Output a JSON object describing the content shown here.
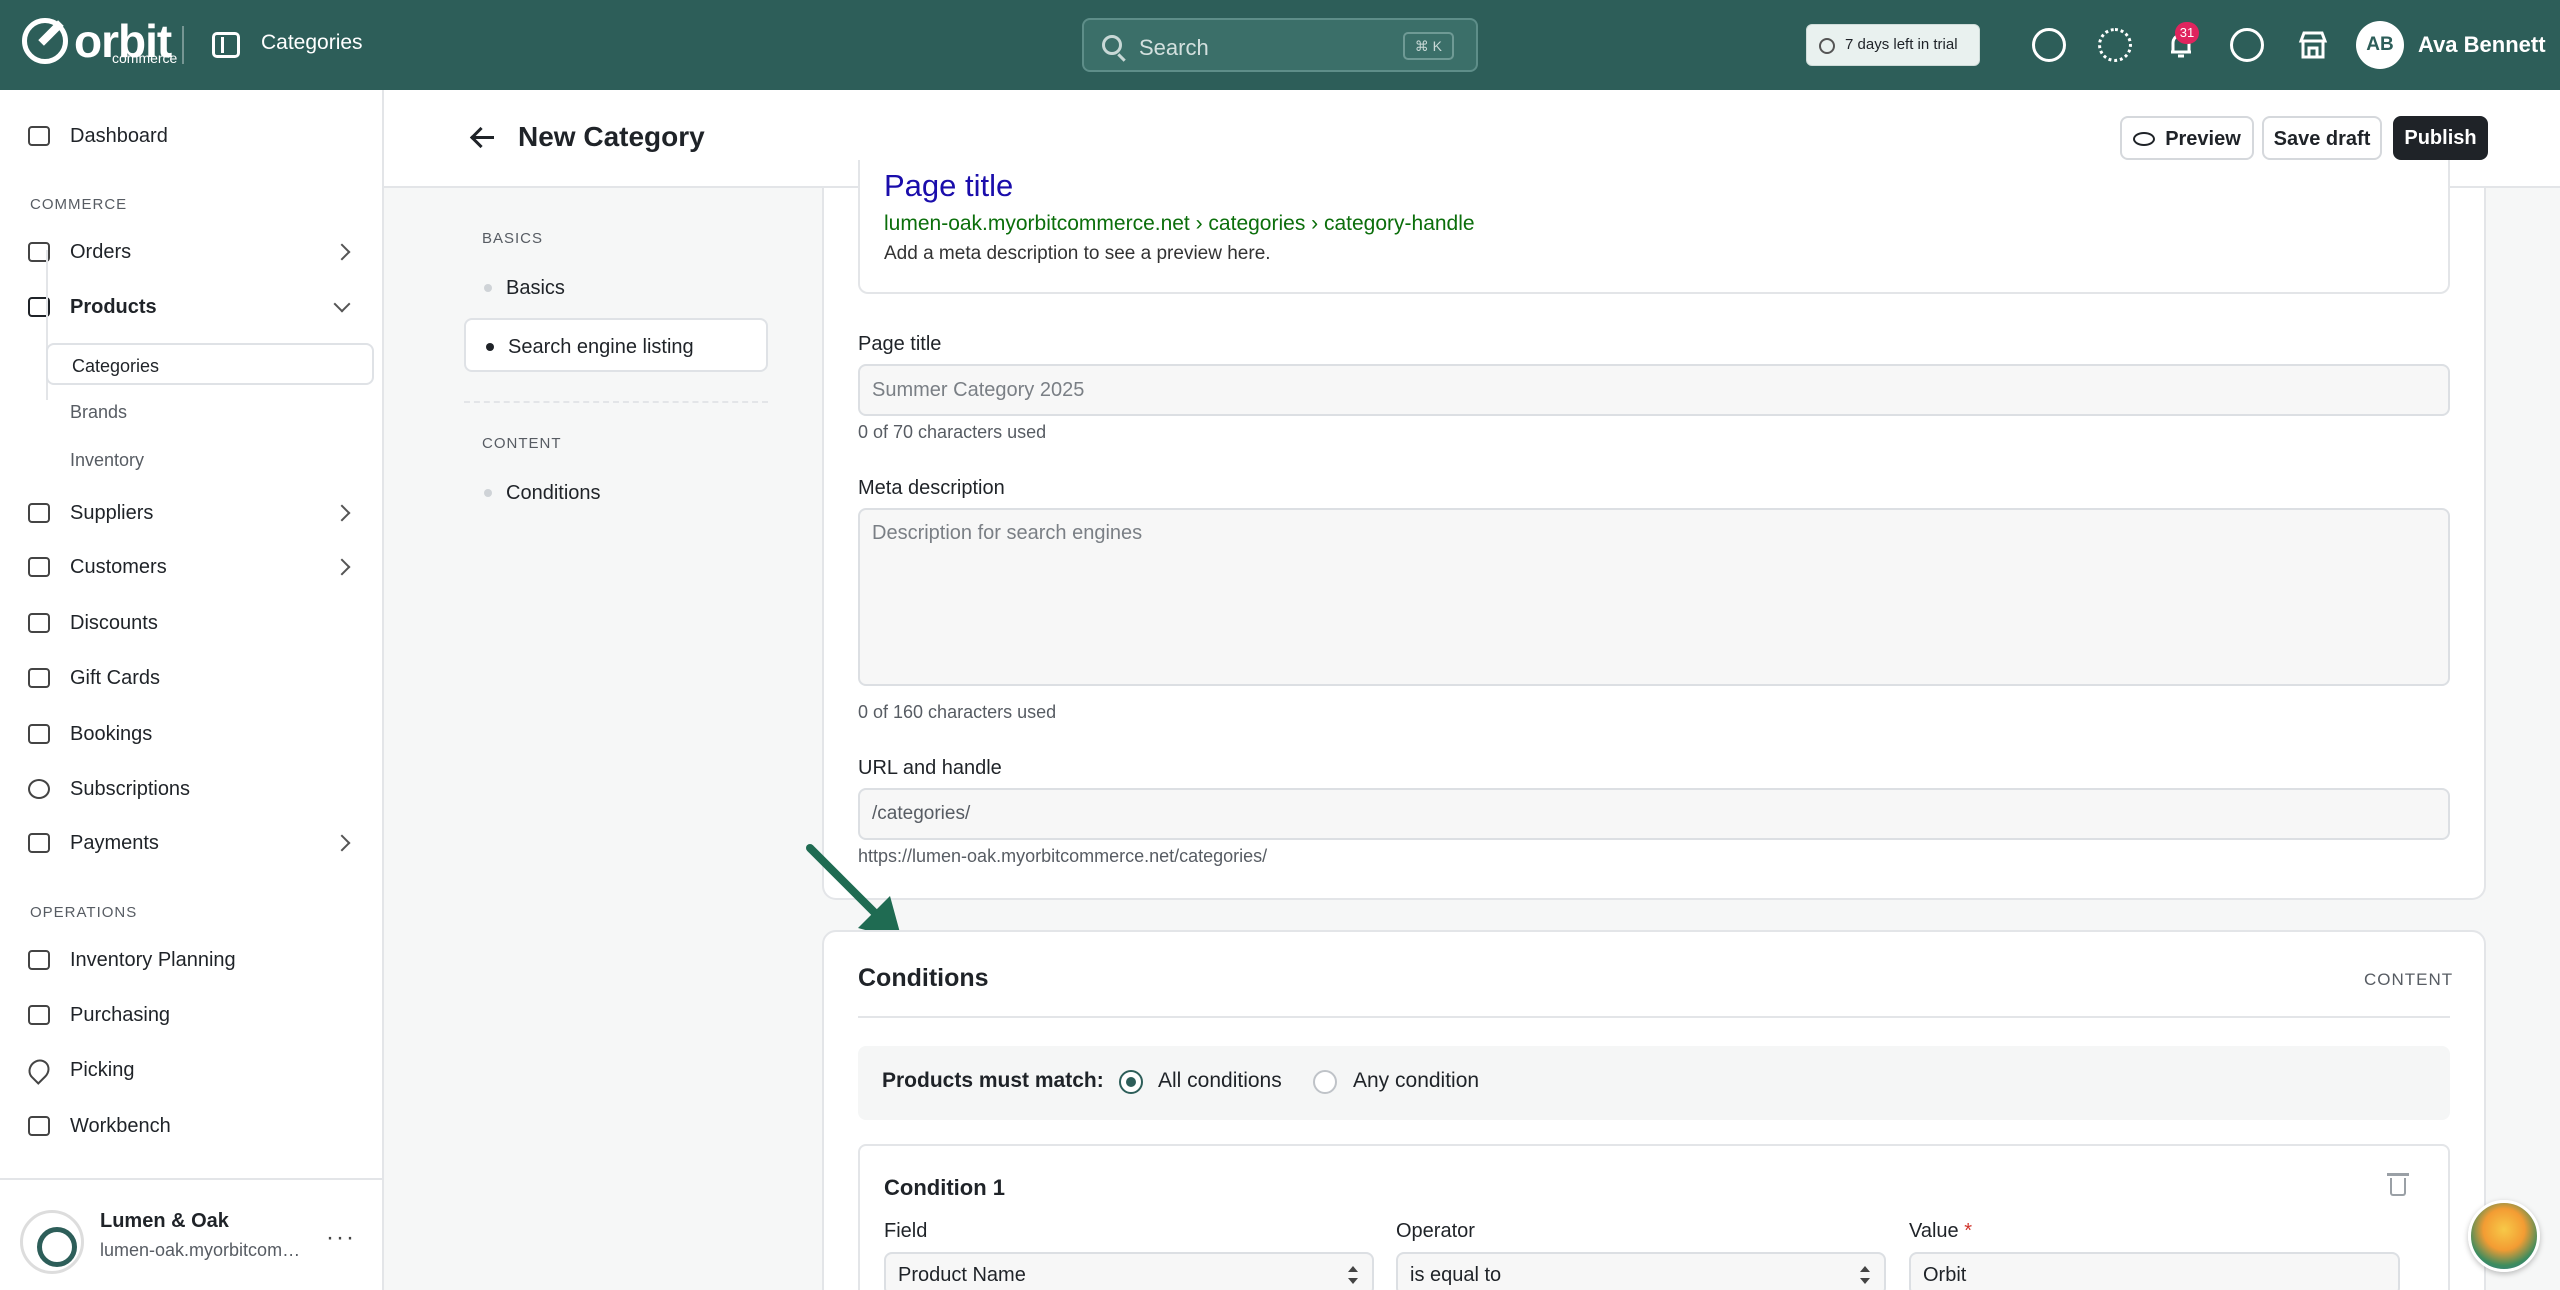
{
  "topbar": {
    "logo_text": "orbit",
    "logo_sub": "commerce",
    "title": "Categories",
    "search_placeholder": "Search",
    "search_shortcut": "⌘ K",
    "trial": "7 days left in trial",
    "notifications_count": "31",
    "user_initials": "AB",
    "user_name": "Ava Bennett",
    "colors": {
      "brand": "#2d5e59",
      "badge": "#e0245e"
    }
  },
  "sidebar": {
    "dashboard": "Dashboard",
    "commerce_label": "COMMERCE",
    "orders": "Orders",
    "products": "Products",
    "products_sub": [
      "Categories",
      "Brands",
      "Inventory"
    ],
    "suppliers": "Suppliers",
    "customers": "Customers",
    "discounts": "Discounts",
    "gift_cards": "Gift Cards",
    "bookings": "Bookings",
    "subscriptions": "Subscriptions",
    "payments": "Payments",
    "operations_label": "OPERATIONS",
    "inventory_planning": "Inventory Planning",
    "purchasing": "Purchasing",
    "picking": "Picking",
    "workbench": "Workbench",
    "store_name": "Lumen & Oak",
    "store_url": "lumen-oak.myorbitcommerce.net"
  },
  "header": {
    "title": "New Category",
    "preview": "Preview",
    "save_draft": "Save draft",
    "publish": "Publish"
  },
  "toc": {
    "basics_label": "BASICS",
    "basics": "Basics",
    "seo": "Search engine listing",
    "content_label": "CONTENT",
    "conditions": "Conditions"
  },
  "seo": {
    "preview_title": "Page title",
    "preview_url": "lumen-oak.myorbitcommerce.net › categories › category-handle",
    "preview_desc": "Add a meta description to see a preview here.",
    "page_title_label": "Page title",
    "page_title_placeholder": "Summer Category 2025",
    "page_title_help": "0 of 70 characters used",
    "meta_label": "Meta description",
    "meta_placeholder": "Description for search engines",
    "meta_help": "0 of 160 characters used",
    "url_label": "URL and handle",
    "url_value": "/categories/",
    "url_help": "https://lumen-oak.myorbitcommerce.net/categories/"
  },
  "conditions": {
    "title": "Conditions",
    "tag": "CONTENT",
    "match_label": "Products must match:",
    "all": "All conditions",
    "any": "Any condition",
    "selected": "All conditions",
    "condition1_title": "Condition 1",
    "field_label": "Field",
    "operator_label": "Operator",
    "value_label": "Value",
    "required_mark": "*",
    "field_value": "Product Name",
    "operator_value": "is equal to",
    "value_value": "Orbit"
  }
}
